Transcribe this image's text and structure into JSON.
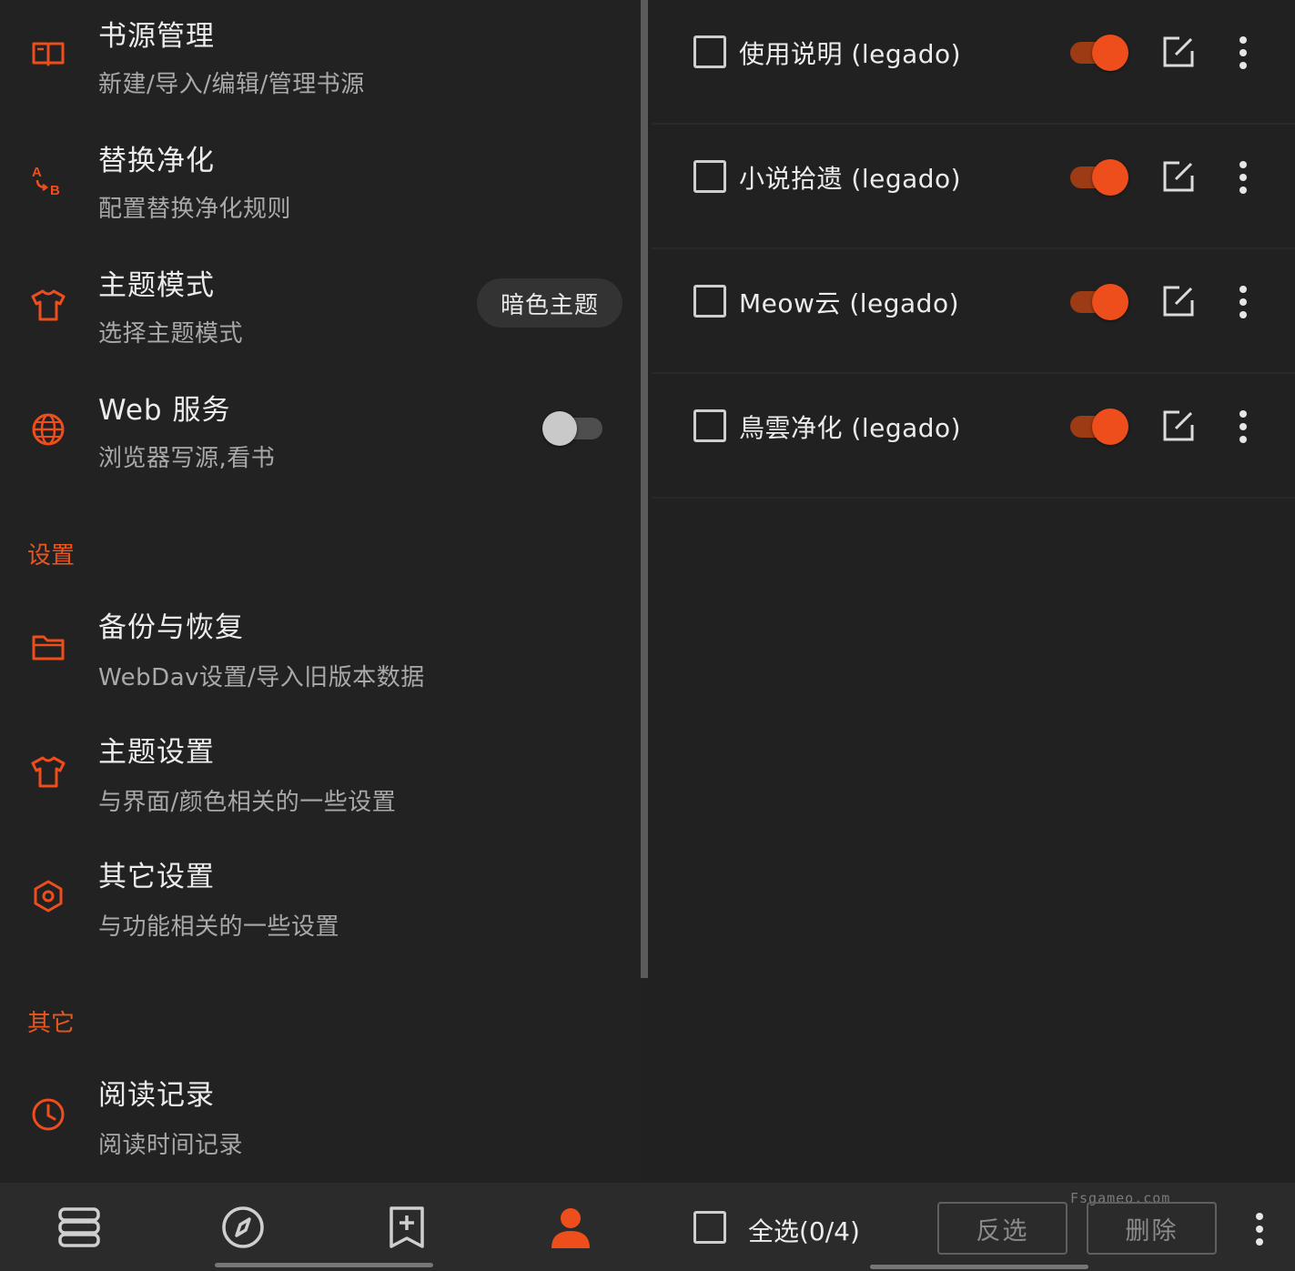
{
  "colors": {
    "accent": "#ee4e1c",
    "background": "#212121",
    "section": "#e8561f"
  },
  "left_pane": {
    "items": [
      {
        "icon": "book-icon",
        "title": "书源管理",
        "subtitle": "新建/导入/编辑/管理书源"
      },
      {
        "icon": "replace-ab-icon",
        "title": "替换净化",
        "subtitle": "配置替换净化规则"
      },
      {
        "icon": "shirt-icon",
        "title": "主题模式",
        "subtitle": "选择主题模式",
        "value": "暗色主题"
      },
      {
        "icon": "globe-icon",
        "title": "Web 服务",
        "subtitle": "浏览器写源,看书",
        "switch_on": false
      }
    ],
    "section_settings": "设置",
    "settings_items": [
      {
        "icon": "folder-icon",
        "title": "备份与恢复",
        "subtitle": "WebDav设置/导入旧版本数据"
      },
      {
        "icon": "shirt-icon",
        "title": "主题设置",
        "subtitle": "与界面/颜色相关的一些设置"
      },
      {
        "icon": "gear-icon",
        "title": "其它设置",
        "subtitle": "与功能相关的一些设置"
      }
    ],
    "section_other": "其它",
    "other_items": [
      {
        "icon": "clock-icon",
        "title": "阅读记录",
        "subtitle": "阅读时间记录"
      }
    ]
  },
  "bottom_nav": [
    {
      "icon": "bookshelf-icon",
      "active": false
    },
    {
      "icon": "compass-icon",
      "active": false
    },
    {
      "icon": "bookmark-add-icon",
      "active": false
    },
    {
      "icon": "person-icon",
      "active": true
    }
  ],
  "right_pane": {
    "rows": [
      {
        "name": "使用说明 (legado)",
        "checked": false,
        "enabled": true
      },
      {
        "name": "小说拾遗 (legado)",
        "checked": false,
        "enabled": true
      },
      {
        "name": "Meow云 (legado)",
        "checked": false,
        "enabled": true
      },
      {
        "name": "鳥雲净化 (legado)",
        "checked": false,
        "enabled": true
      }
    ],
    "bottom_bar": {
      "select_all": "全选(0/4)",
      "invert": "反选",
      "delete": "删除",
      "watermark": "Fsgameo.com"
    }
  }
}
